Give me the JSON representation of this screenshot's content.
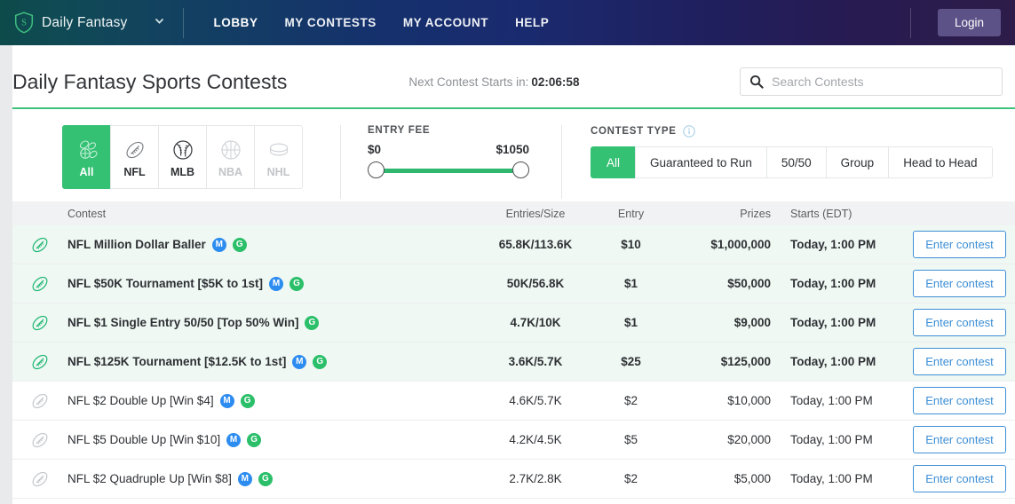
{
  "topbar": {
    "logo_icon": "shield-s-icon",
    "brand": "Daily Fantasy",
    "dropdown_icon": "chevron-down-icon",
    "nav": [
      {
        "label": "LOBBY",
        "active": true
      },
      {
        "label": "MY CONTESTS",
        "active": false
      },
      {
        "label": "MY ACCOUNT",
        "active": false
      },
      {
        "label": "HELP",
        "active": false
      }
    ],
    "login_label": "Login",
    "login_color": "#5c5287"
  },
  "header": {
    "page_title": "Daily Fantasy Sports Contests",
    "countdown_label": "Next Contest Starts in:",
    "countdown_value": "02:06:58",
    "search_icon": "search-icon",
    "search_placeholder": "Search Contests",
    "search_value": "",
    "accent_color": "#3ec27c"
  },
  "filters": {
    "sports": [
      {
        "label": "All",
        "icon": "all-sports-icon",
        "active": true,
        "disabled": false
      },
      {
        "label": "NFL",
        "icon": "football-icon",
        "active": false,
        "disabled": false
      },
      {
        "label": "MLB",
        "icon": "baseball-icon",
        "active": false,
        "disabled": false
      },
      {
        "label": "NBA",
        "icon": "basketball-icon",
        "active": false,
        "disabled": true
      },
      {
        "label": "NHL",
        "icon": "hockey-puck-icon",
        "active": false,
        "disabled": true
      }
    ],
    "entry_fee": {
      "label": "ENTRY FEE",
      "min": "$0",
      "max": "$1050",
      "track_color": "#2fb76d"
    },
    "contest_type": {
      "label": "CONTEST TYPE",
      "info_icon": "info-icon",
      "options": [
        {
          "label": "All",
          "active": true
        },
        {
          "label": "Guaranteed to Run",
          "active": false
        },
        {
          "label": "50/50",
          "active": false
        },
        {
          "label": "Group",
          "active": false
        },
        {
          "label": "Head to Head",
          "active": false
        }
      ]
    }
  },
  "table": {
    "columns": {
      "contest": "Contest",
      "entries": "Entries/Size",
      "entry": "Entry",
      "prizes": "Prizes",
      "starts": "Starts (EDT)"
    },
    "action_label": "Enter contest",
    "rows": [
      {
        "icon": "football-icon",
        "highlight": true,
        "name": "NFL Million Dollar Baller",
        "badges": [
          "M",
          "G"
        ],
        "entries": "65.8K/113.6K",
        "entry": "$10",
        "prizes": "$1,000,000",
        "starts": "Today, 1:00 PM"
      },
      {
        "icon": "football-icon",
        "highlight": true,
        "name": "NFL $50K Tournament [$5K to 1st]",
        "badges": [
          "M",
          "G"
        ],
        "entries": "50K/56.8K",
        "entry": "$1",
        "prizes": "$50,000",
        "starts": "Today, 1:00 PM"
      },
      {
        "icon": "football-icon",
        "highlight": true,
        "name": "NFL $1 Single Entry 50/50 [Top 50% Win]",
        "badges": [
          "G"
        ],
        "entries": "4.7K/10K",
        "entry": "$1",
        "prizes": "$9,000",
        "starts": "Today, 1:00 PM"
      },
      {
        "icon": "football-icon",
        "highlight": true,
        "name": "NFL $125K Tournament [$12.5K to 1st]",
        "badges": [
          "M",
          "G"
        ],
        "entries": "3.6K/5.7K",
        "entry": "$25",
        "prizes": "$125,000",
        "starts": "Today, 1:00 PM"
      },
      {
        "icon": "football-icon",
        "highlight": false,
        "name": "NFL $2 Double Up [Win $4]",
        "badges": [
          "M",
          "G"
        ],
        "entries": "4.6K/5.7K",
        "entry": "$2",
        "prizes": "$10,000",
        "starts": "Today, 1:00 PM"
      },
      {
        "icon": "football-icon",
        "highlight": false,
        "name": "NFL $5 Double Up [Win $10]",
        "badges": [
          "M",
          "G"
        ],
        "entries": "4.2K/4.5K",
        "entry": "$5",
        "prizes": "$20,000",
        "starts": "Today, 1:00 PM"
      },
      {
        "icon": "football-icon",
        "highlight": false,
        "name": "NFL $2 Quadruple Up [Win $8]",
        "badges": [
          "M",
          "G"
        ],
        "entries": "2.7K/2.8K",
        "entry": "$2",
        "prizes": "$5,000",
        "starts": "Today, 1:00 PM"
      }
    ]
  }
}
